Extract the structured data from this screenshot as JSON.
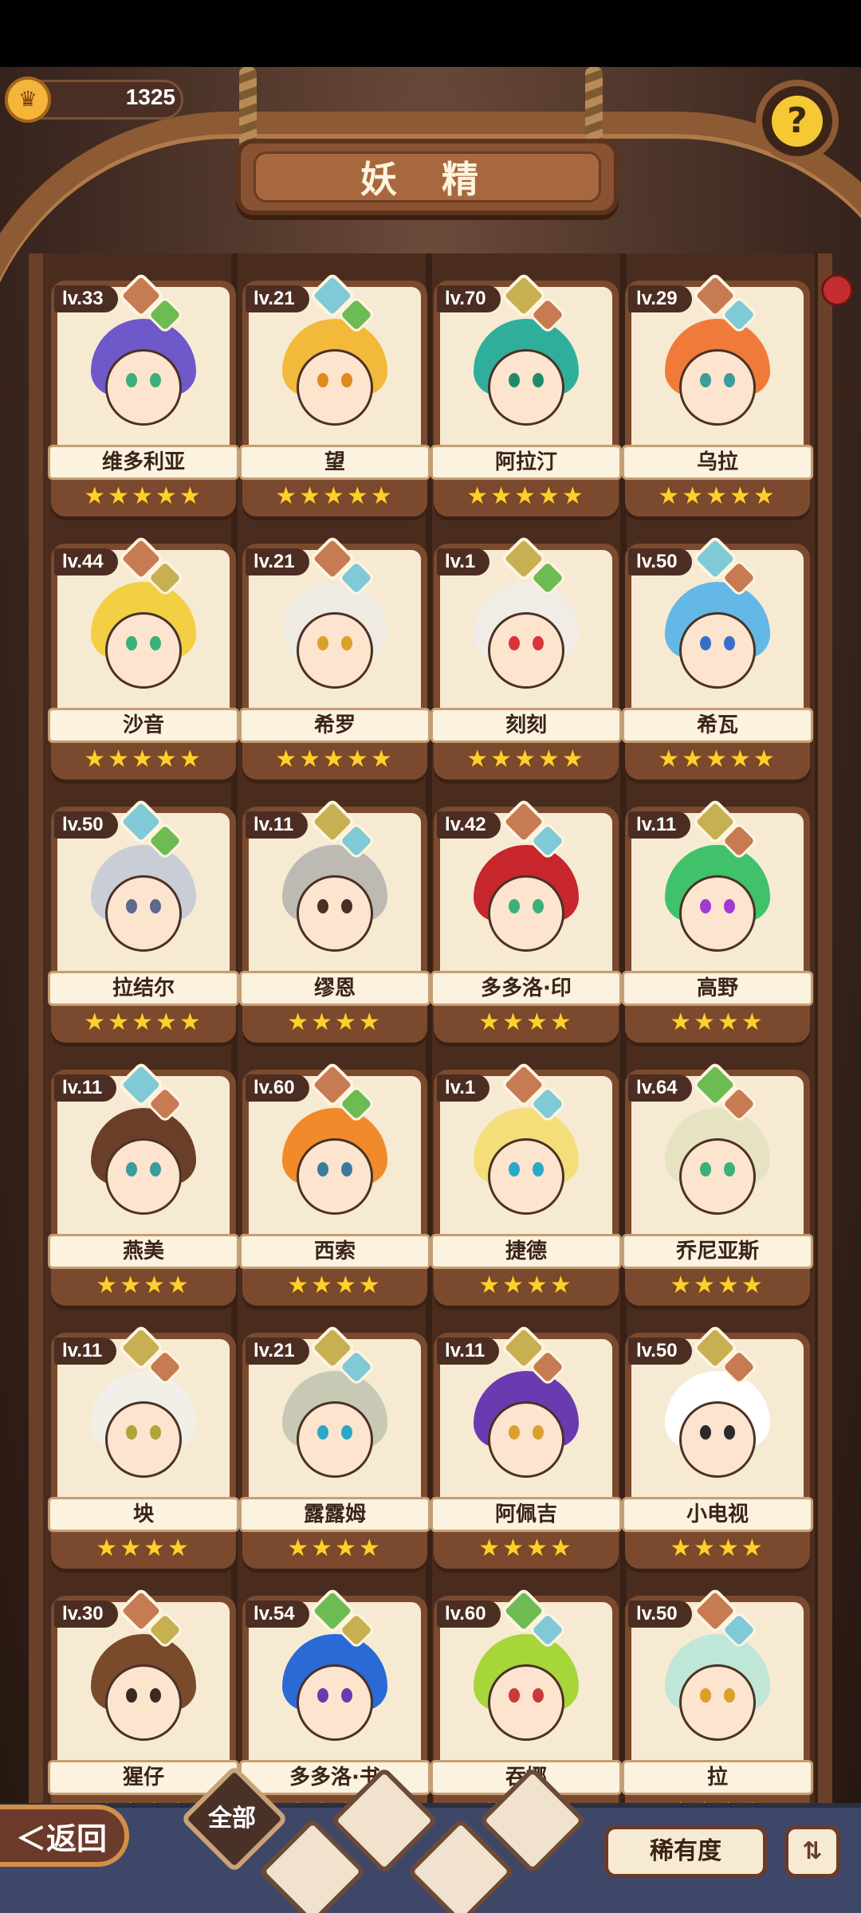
{
  "header": {
    "coins": "1325",
    "title": "妖 精",
    "help_icon": "question-mark-icon"
  },
  "fairies": [
    {
      "level": "lv.33",
      "name": "维多利亚",
      "stars": "★★★★★",
      "hair": "#6f58c9",
      "eye": "#3bb07a",
      "gems": [
        "#c77b52",
        "#6dbb53"
      ]
    },
    {
      "level": "lv.21",
      "name": "望",
      "stars": "★★★★★",
      "hair": "#f2b93a",
      "eye": "#e08a1e",
      "gems": [
        "#7fcad6",
        "#6dbb53"
      ]
    },
    {
      "level": "lv.70",
      "name": "阿拉汀",
      "stars": "★★★★★",
      "hair": "#2fae9b",
      "eye": "#1f8b6a",
      "gems": [
        "#c7b052",
        "#c77b52"
      ]
    },
    {
      "level": "lv.29",
      "name": "乌拉",
      "stars": "★★★★★",
      "hair": "#f07a3a",
      "eye": "#3b9c9c",
      "gems": [
        "#c77b52",
        "#7fcad6"
      ]
    },
    {
      "level": "lv.44",
      "name": "沙音",
      "stars": "★★★★★",
      "hair": "#f3cf43",
      "eye": "#3bb07a",
      "gems": [
        "#c77b52",
        "#c7b052"
      ]
    },
    {
      "level": "lv.21",
      "name": "希罗",
      "stars": "★★★★★",
      "hair": "#efeae2",
      "eye": "#d9a12a",
      "gems": [
        "#c77b52",
        "#7fcad6"
      ]
    },
    {
      "level": "lv.1",
      "name": "刻刻",
      "stars": "★★★★★",
      "hair": "#f1ece6",
      "eye": "#d9343a",
      "gems": [
        "#c7b052",
        "#6dbb53"
      ]
    },
    {
      "level": "lv.50",
      "name": "希瓦",
      "stars": "★★★★★",
      "hair": "#63b8e6",
      "eye": "#3a6fc9",
      "gems": [
        "#7fcad6",
        "#c77b52"
      ]
    },
    {
      "level": "lv.50",
      "name": "拉结尔",
      "stars": "★★★★★",
      "hair": "#c9cdd6",
      "eye": "#5a6b8c",
      "gems": [
        "#7fcad6",
        "#6dbb53"
      ]
    },
    {
      "level": "lv.11",
      "name": "缪恩",
      "stars": "★★★★",
      "hair": "#bdbab4",
      "eye": "#4a3125",
      "gems": [
        "#c7b052",
        "#7fcad6"
      ]
    },
    {
      "level": "lv.42",
      "name": "多多洛·印",
      "stars": "★★★★",
      "hair": "#c7262c",
      "eye": "#3bb07a",
      "gems": [
        "#c77b52",
        "#7fcad6"
      ]
    },
    {
      "level": "lv.11",
      "name": "高野",
      "stars": "★★★★",
      "hair": "#3fc26a",
      "eye": "#a23ad0",
      "gems": [
        "#c7b052",
        "#c77b52"
      ]
    },
    {
      "level": "lv.11",
      "name": "燕美",
      "stars": "★★★★",
      "hair": "#6a3f2a",
      "eye": "#3b9c9c",
      "gems": [
        "#7fcad6",
        "#c77b52"
      ]
    },
    {
      "level": "lv.60",
      "name": "西索",
      "stars": "★★★★",
      "hair": "#f08a2a",
      "eye": "#3a7a9c",
      "gems": [
        "#c77b52",
        "#6dbb53"
      ]
    },
    {
      "level": "lv.1",
      "name": "捷德",
      "stars": "★★★★",
      "hair": "#f4de7a",
      "eye": "#2aa8c9",
      "gems": [
        "#c77b52",
        "#7fcad6"
      ]
    },
    {
      "level": "lv.64",
      "name": "乔尼亚斯",
      "stars": "★★★★",
      "hair": "#e6e3c2",
      "eye": "#3bb07a",
      "gems": [
        "#6dbb53",
        "#c77b52"
      ]
    },
    {
      "level": "lv.11",
      "name": "坱",
      "stars": "★★★★",
      "hair": "#f2efe8",
      "eye": "#b0a43a",
      "gems": [
        "#c7b052",
        "#c77b52"
      ]
    },
    {
      "level": "lv.21",
      "name": "露露姆",
      "stars": "★★★★",
      "hair": "#c7c9b4",
      "eye": "#2aa8c9",
      "gems": [
        "#c7b052",
        "#7fcad6"
      ]
    },
    {
      "level": "lv.11",
      "name": "阿佩吉",
      "stars": "★★★★",
      "hair": "#6a3ab0",
      "eye": "#d9a12a",
      "gems": [
        "#c7b052",
        "#c77b52"
      ]
    },
    {
      "level": "lv.50",
      "name": "小电视",
      "stars": "★★★★",
      "hair": "#ffffff",
      "eye": "#2a2a2a",
      "gems": [
        "#c7b052",
        "#c77b52"
      ]
    },
    {
      "level": "lv.30",
      "name": "猩仔",
      "stars": "★★★★",
      "hair": "#7a4a2a",
      "eye": "#3a2a20",
      "gems": [
        "#c77b52",
        "#c7b052"
      ]
    },
    {
      "level": "lv.54",
      "name": "多多洛·书",
      "stars": "★★★★",
      "hair": "#2a6ad6",
      "eye": "#6a3ab0",
      "gems": [
        "#6dbb53",
        "#c7b052"
      ]
    },
    {
      "level": "lv.60",
      "name": "吞娜",
      "stars": "★★★★",
      "hair": "#a6d63a",
      "eye": "#c93a3a",
      "gems": [
        "#6dbb53",
        "#7fcad6"
      ]
    },
    {
      "level": "lv.50",
      "name": "拉",
      "stars": "★★★★",
      "hair": "#bfe6d6",
      "eye": "#d9a12a",
      "gems": [
        "#c77b52",
        "#7fcad6"
      ]
    }
  ],
  "bottom": {
    "back_label": "＜返回",
    "filter_all": "全部",
    "filter_icons": [
      "drop-icon",
      "sprout-icon",
      "mountain-icon",
      "mountain-snow-icon"
    ],
    "rarity_label": "稀有度",
    "sort_icon": "sort-icon"
  }
}
